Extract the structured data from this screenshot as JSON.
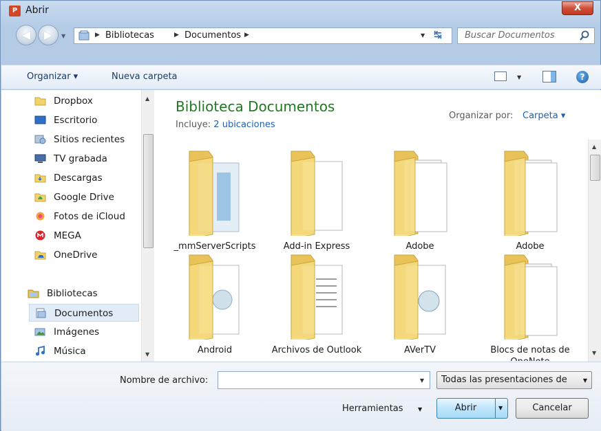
{
  "window": {
    "title": "Abrir",
    "app_icon_text": "P",
    "close_label": "X"
  },
  "address": {
    "crumbs": [
      "Bibliotecas",
      "Documentos"
    ],
    "search_placeholder": "Buscar Documentos"
  },
  "toolbar": {
    "organize": "Organizar ▾",
    "new_folder": "Nueva carpeta",
    "help_label": "?"
  },
  "sidebar": {
    "items": [
      {
        "label": "Dropbox",
        "icon": "dropbox-icon"
      },
      {
        "label": "Escritorio",
        "icon": "desktop-icon"
      },
      {
        "label": "Sitios recientes",
        "icon": "recent-places-icon"
      },
      {
        "label": "TV grabada",
        "icon": "tv-icon"
      },
      {
        "label": "Descargas",
        "icon": "downloads-icon"
      },
      {
        "label": "Google Drive",
        "icon": "google-drive-icon"
      },
      {
        "label": "Fotos de iCloud",
        "icon": "icloud-photos-icon"
      },
      {
        "label": "MEGA",
        "icon": "mega-icon"
      },
      {
        "label": "OneDrive",
        "icon": "onedrive-icon"
      }
    ],
    "libraries": {
      "label": "Bibliotecas",
      "children": [
        {
          "label": "Documentos",
          "selected": true
        },
        {
          "label": "Imágenes"
        },
        {
          "label": "Música"
        }
      ]
    }
  },
  "content": {
    "title": "Biblioteca Documentos",
    "includes_label": "Incluye:",
    "includes_link": "2 ubicaciones",
    "arrange_label": "Organizar por:",
    "arrange_value": "Carpeta ▾",
    "folders": [
      {
        "name": "_mmServerScripts"
      },
      {
        "name": "Add-in Express"
      },
      {
        "name": "Adobe"
      },
      {
        "name": "Adobe"
      },
      {
        "name": "Android"
      },
      {
        "name": "Archivos de Outlook"
      },
      {
        "name": "AVerTV"
      },
      {
        "name": "Blocs de notas de OneNote"
      }
    ]
  },
  "bottom": {
    "filename_label": "Nombre de archivo:",
    "filename_value": "",
    "filetype": "Todas las presentaciones de",
    "tools": "Herramientas",
    "open": "Abrir",
    "cancel": "Cancelar"
  },
  "colors": {
    "title_green": "#1d7a21",
    "link_blue": "#1e5fb3",
    "folder_yellow": "#f2d36b"
  }
}
